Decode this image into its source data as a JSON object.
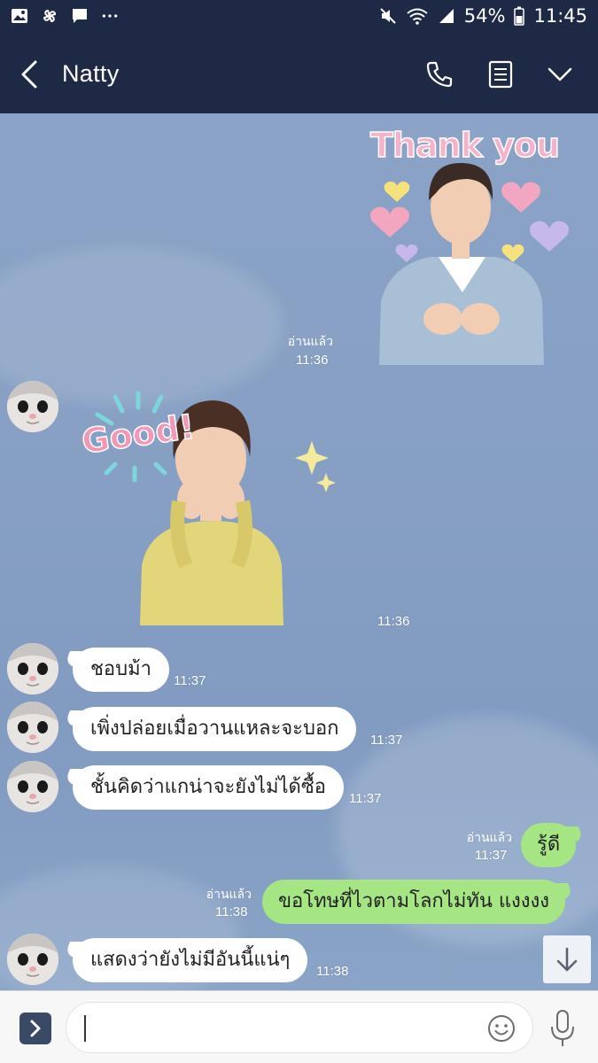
{
  "status_bar": {
    "battery": "54%",
    "time": "11:45",
    "left_icons": [
      "gallery-icon",
      "pinwheel-icon",
      "message-icon",
      "more-dots-icon"
    ],
    "right_icons": [
      "mute-icon",
      "wifi-icon",
      "signal-icon",
      "battery-icon"
    ]
  },
  "header": {
    "title": "Natty",
    "icons": [
      "back-arrow-icon",
      "phone-icon",
      "notes-icon",
      "chevron-down-icon"
    ]
  },
  "messages": [
    {
      "from": "me",
      "type": "sticker",
      "sticker_text": "Thank you",
      "read": "อ่านแล้ว",
      "time": "11:36"
    },
    {
      "from": "them",
      "type": "sticker",
      "sticker_text": "Good!",
      "time": "11:36"
    },
    {
      "from": "them",
      "type": "text",
      "text": "ชอบม้า",
      "time": "11:37"
    },
    {
      "from": "them",
      "type": "text",
      "text": "เพิ่งปล่อยเมื่อวานแหละจะบอก",
      "time": "11:37"
    },
    {
      "from": "them",
      "type": "text",
      "text": "ชั้นคิดว่าแกน่าจะยังไม่ได้ซื้อ",
      "time": "11:37"
    },
    {
      "from": "me",
      "type": "text",
      "text": "รู้ดี",
      "read": "อ่านแล้ว",
      "time": "11:37"
    },
    {
      "from": "me",
      "type": "text",
      "text": "ขอโทษที่ไวตามโลกไม่ทัน แงงงง",
      "read": "อ่านแล้ว",
      "time": "11:38"
    },
    {
      "from": "them",
      "type": "text",
      "text": "แสดงว่ายังไม่มีอันนี้แน่ๆ",
      "time": "11:38"
    }
  ],
  "input_bar": {
    "value": "",
    "icons": [
      "chevron-right-icon",
      "smiley-icon",
      "microphone-icon"
    ]
  },
  "colors": {
    "header_bg": "#1e2a45",
    "chat_bg": "#869fc3",
    "outgoing_bubble": "#a5e584",
    "incoming_bubble": "#ffffff"
  }
}
